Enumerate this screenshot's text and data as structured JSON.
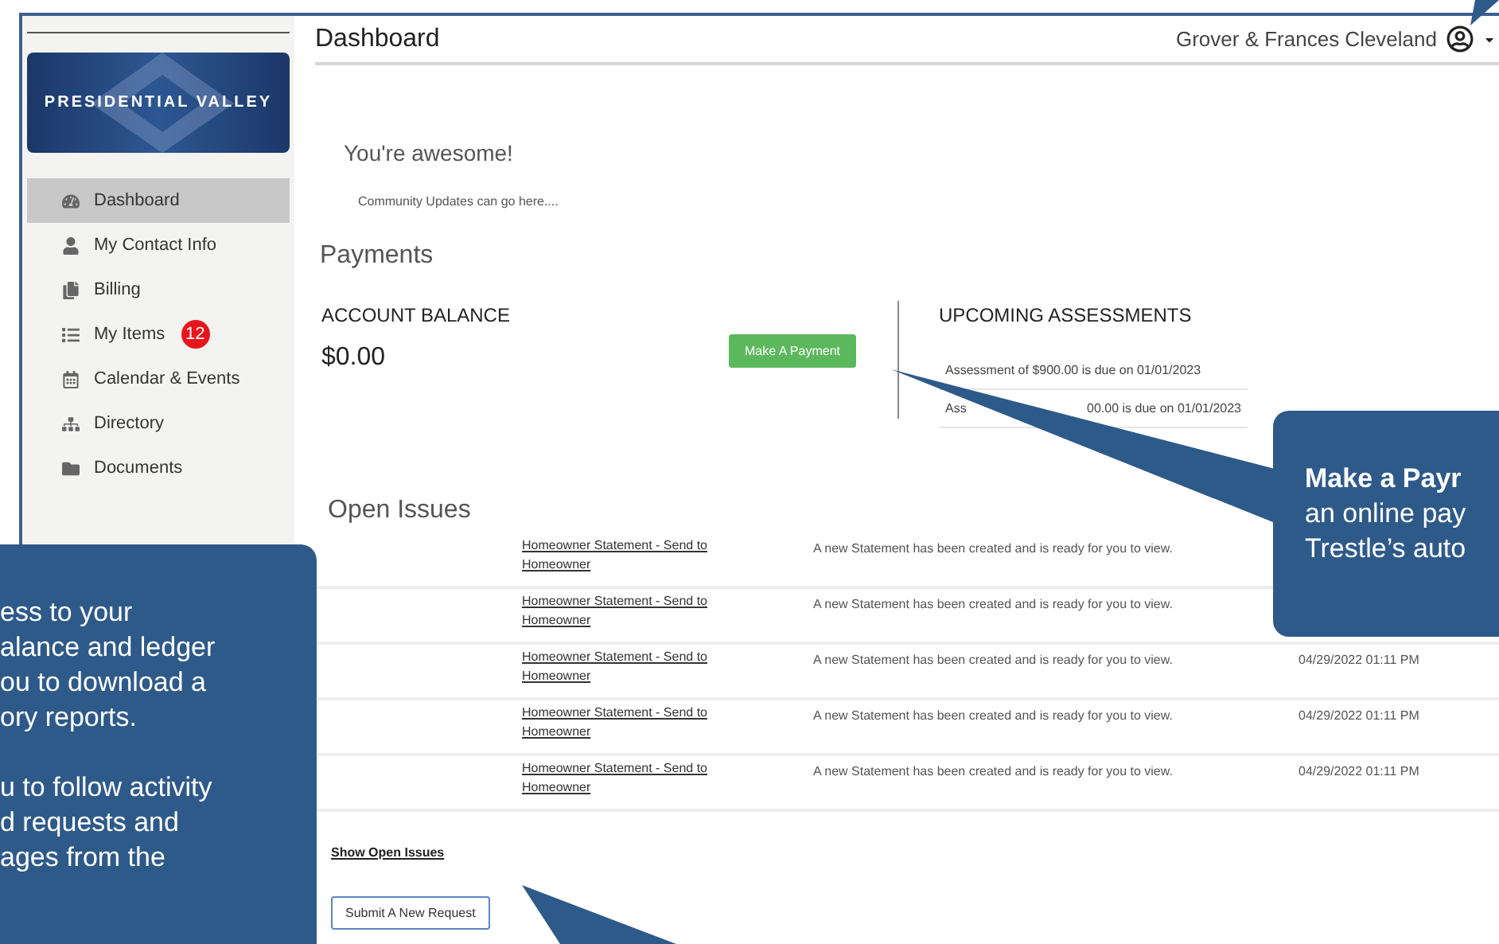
{
  "sidebar": {
    "logo_text": "PRESIDENTIAL VALLEY",
    "items": [
      {
        "label": "Dashboard",
        "selected": true
      },
      {
        "label": "My Contact Info",
        "selected": false
      },
      {
        "label": "Billing",
        "selected": false
      },
      {
        "label": "My Items",
        "selected": false,
        "badge": "12"
      },
      {
        "label": "Calendar & Events",
        "selected": false
      },
      {
        "label": "Directory",
        "selected": false
      },
      {
        "label": "Documents",
        "selected": false
      }
    ]
  },
  "header": {
    "title": "Dashboard",
    "user_name": "Grover & Frances Cleveland"
  },
  "welcome": {
    "title": "You're awesome!",
    "text": "Community Updates can go here...."
  },
  "payments": {
    "title": "Payments",
    "balance_label": "ACCOUNT BALANCE",
    "balance": "$0.00",
    "pay_button": "Make A Payment",
    "assessments_title": "UPCOMING ASSESSMENTS",
    "assessments": [
      {
        "text": "Assessment of $900.00 is due on 01/01/2023"
      },
      {
        "text_left": "Ass",
        "text_right": "00.00 is due on 01/01/2023"
      }
    ]
  },
  "open_issues": {
    "title": "Open Issues",
    "rows": [
      {
        "subject": "Homeowner Statement - Send to Homeowner",
        "message": "A new Statement has been created and is ready for you to view."
      },
      {
        "subject": "Homeowner Statement - Send to Homeowner",
        "message": "A new Statement has been created and is ready for you to view."
      },
      {
        "subject": "Homeowner Statement - Send to Homeowner",
        "message": "A new Statement has been created and is ready for you to view.",
        "date": "04/29/2022 01:11 PM"
      },
      {
        "subject": "Homeowner Statement - Send to Homeowner",
        "message": "A new Statement has been created and is ready for you to view.",
        "date": "04/29/2022 01:11 PM"
      },
      {
        "subject": "Homeowner Statement - Send to Homeowner",
        "message": "A new Statement has been created and is ready for you to view.",
        "date": "04/29/2022 01:11 PM"
      }
    ],
    "show_link": "Show Open Issues",
    "submit_button": "Submit A New Request"
  },
  "callouts": [
    {
      "paragraphs": [
        [
          "ess to your",
          "alance and ledger",
          "ou to download a",
          "ory reports."
        ],
        [
          "u to follow activity",
          "d requests and",
          "ages from the"
        ]
      ]
    },
    {
      "paragraphs": [
        [
          "**Make a Payr**",
          "an online pay",
          "Trestle’s auto"
        ]
      ]
    }
  ]
}
